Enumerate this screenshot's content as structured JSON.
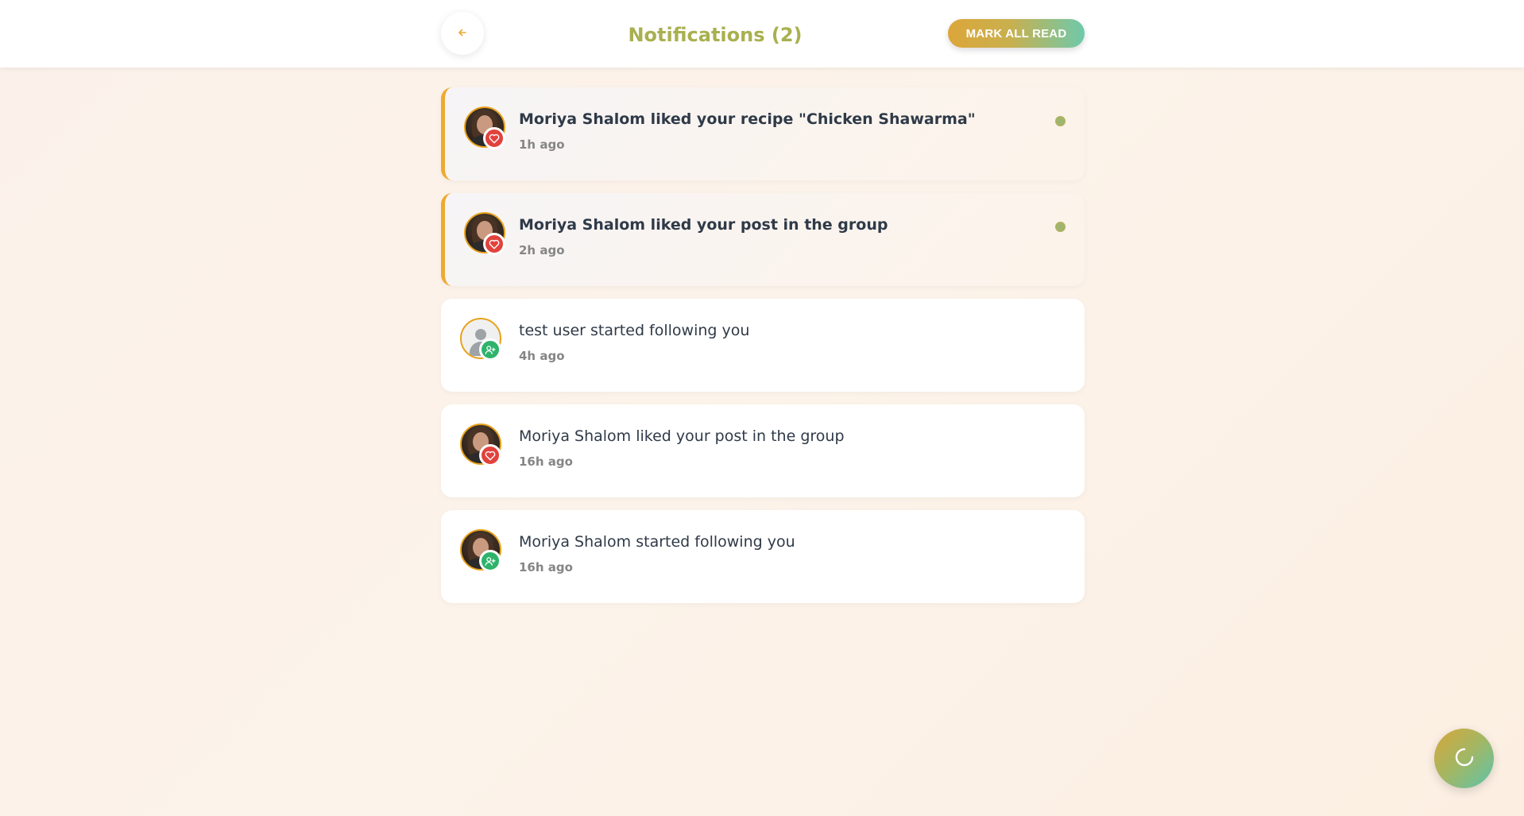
{
  "header": {
    "title": "Notifications (2)",
    "back_icon": "arrow-left-icon",
    "mark_all_label": "MARK ALL READ"
  },
  "notifications": [
    {
      "actor": "Moriya Shalom",
      "text": "Moriya Shalom liked your recipe \"Chicken Shawarma\"",
      "time": "1h ago",
      "type": "like",
      "unread": true
    },
    {
      "actor": "Moriya Shalom",
      "text": "Moriya Shalom liked your post in the group",
      "time": "2h ago",
      "type": "like",
      "unread": true
    },
    {
      "actor": "test user",
      "text": "test user started following you",
      "time": "4h ago",
      "type": "follow",
      "unread": false
    },
    {
      "actor": "Moriya Shalom",
      "text": "Moriya Shalom liked your post in the group",
      "time": "16h ago",
      "type": "like",
      "unread": false
    },
    {
      "actor": "Moriya Shalom",
      "text": "Moriya Shalom started following you",
      "time": "16h ago",
      "type": "follow",
      "unread": false
    }
  ],
  "fab_icon": "refresh-icon",
  "colors": {
    "accent_orange": "#f0a930",
    "title_color": "#a9b04f",
    "like_badge": "#e2423c",
    "follow_badge": "#2fb36b",
    "unread_dot": "#9db66d"
  }
}
